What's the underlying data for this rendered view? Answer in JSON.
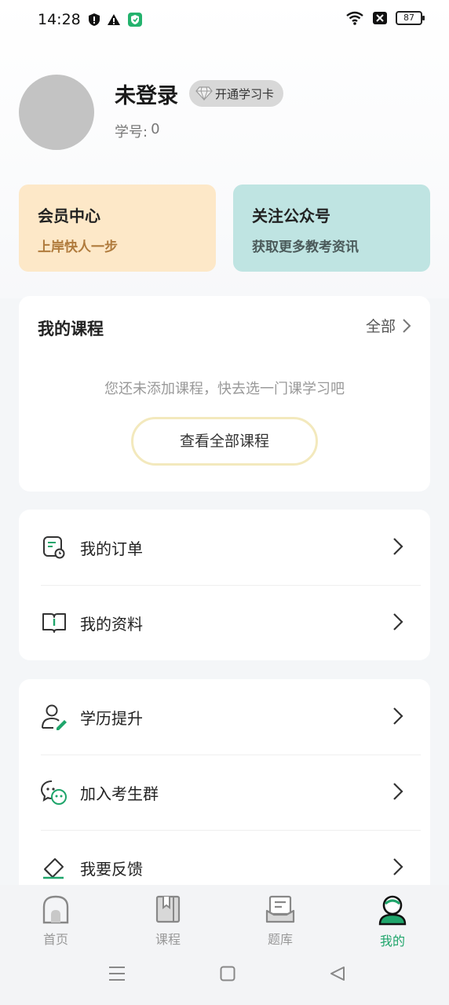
{
  "status_bar": {
    "time": "14:28",
    "battery": "87",
    "icons_left": [
      "shield-alert-icon",
      "warning-icon",
      "app-shield-icon"
    ],
    "icons_right": [
      "wifi-icon",
      "no-sim-icon",
      "battery-icon"
    ]
  },
  "profile": {
    "name": "未登录",
    "badge_label": "开通学习卡",
    "student_id_label": "学号:",
    "student_id_value": "0"
  },
  "promos": [
    {
      "title": "会员中心",
      "subtitle": "上岸快人一步",
      "color": "#fde8c8"
    },
    {
      "title": "关注公众号",
      "subtitle": "获取更多教考资讯",
      "color": "#bfe4e2"
    }
  ],
  "courses": {
    "title": "我的课程",
    "all_label": "全部",
    "empty_text": "您还未添加课程，快去选一门课学习吧",
    "button_label": "查看全部课程"
  },
  "menu_group_1": [
    {
      "label": "我的订单",
      "icon": "order-icon"
    },
    {
      "label": "我的资料",
      "icon": "book-icon"
    }
  ],
  "menu_group_2": [
    {
      "label": "学历提升",
      "icon": "user-edit-icon"
    },
    {
      "label": "加入考生群",
      "icon": "chat-group-icon"
    },
    {
      "label": "我要反馈",
      "icon": "feedback-icon"
    }
  ],
  "bottom_nav": [
    {
      "label": "首页",
      "icon": "home-icon",
      "active": false
    },
    {
      "label": "课程",
      "icon": "course-book-icon",
      "active": false
    },
    {
      "label": "题库",
      "icon": "question-bank-icon",
      "active": false
    },
    {
      "label": "我的",
      "icon": "profile-icon",
      "active": true
    }
  ],
  "colors": {
    "accent": "#1fa56b",
    "page_bg": "#f4f6f8"
  }
}
